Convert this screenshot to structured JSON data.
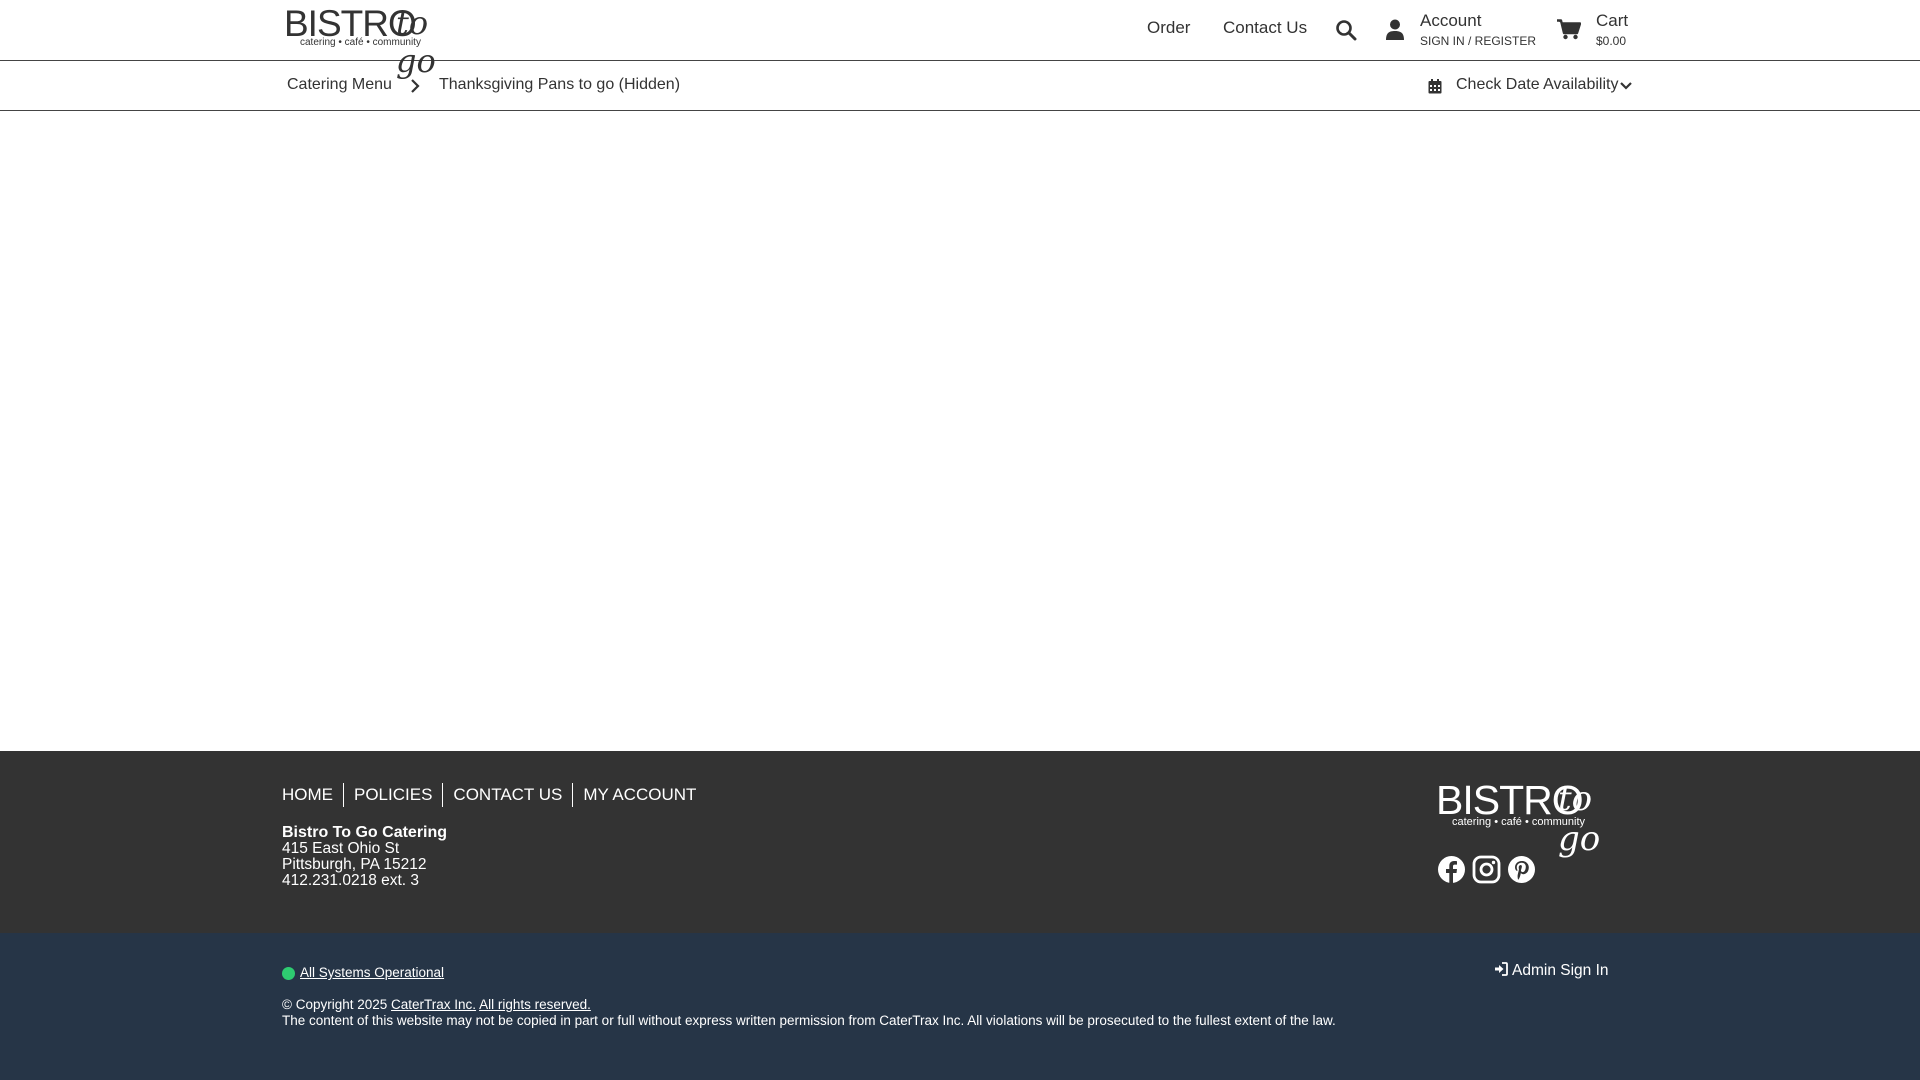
{
  "header": {
    "logo": {
      "word": "BISTRO",
      "script": "to go",
      "tagline": "catering • café • community"
    },
    "nav": {
      "order": "Order",
      "contact": "Contact Us"
    },
    "account": {
      "title": "Account",
      "sub": "SIGN IN / REGISTER"
    },
    "cart": {
      "title": "Cart",
      "total": "$0.00"
    }
  },
  "breadcrumb": {
    "items": [
      "Catering Menu",
      "Thanksgiving Pans to go (Hidden)"
    ],
    "check_date": "Check Date Availability"
  },
  "footer": {
    "nav": [
      "HOME",
      "POLICIES",
      "CONTACT US",
      "MY ACCOUNT"
    ],
    "business": {
      "name": "Bistro To Go Catering",
      "address1": "415 East Ohio St",
      "address2": "Pittsburgh, PA 15212",
      "phone": "412.231.0218 ext. 3"
    },
    "logo": {
      "word": "BISTRO",
      "script": "to go",
      "tagline": "catering • café • community"
    },
    "social": [
      "facebook-icon",
      "instagram-icon",
      "pinterest-icon"
    ]
  },
  "subfooter": {
    "status": "All Systems Operational",
    "admin": "Admin Sign In",
    "copyright_prefix": "© Copyright 2025",
    "company": "CaterTrax Inc.",
    "rights": "All rights reserved.",
    "legal": "The content of this website may not be copied in part or full without express written permission from CaterTrax Inc. All violations will be prosecuted to the fullest extent of the law."
  },
  "colors": {
    "footer_bg": "#333333",
    "subfooter_bg": "#263547",
    "status_ok": "#2ecc71"
  }
}
